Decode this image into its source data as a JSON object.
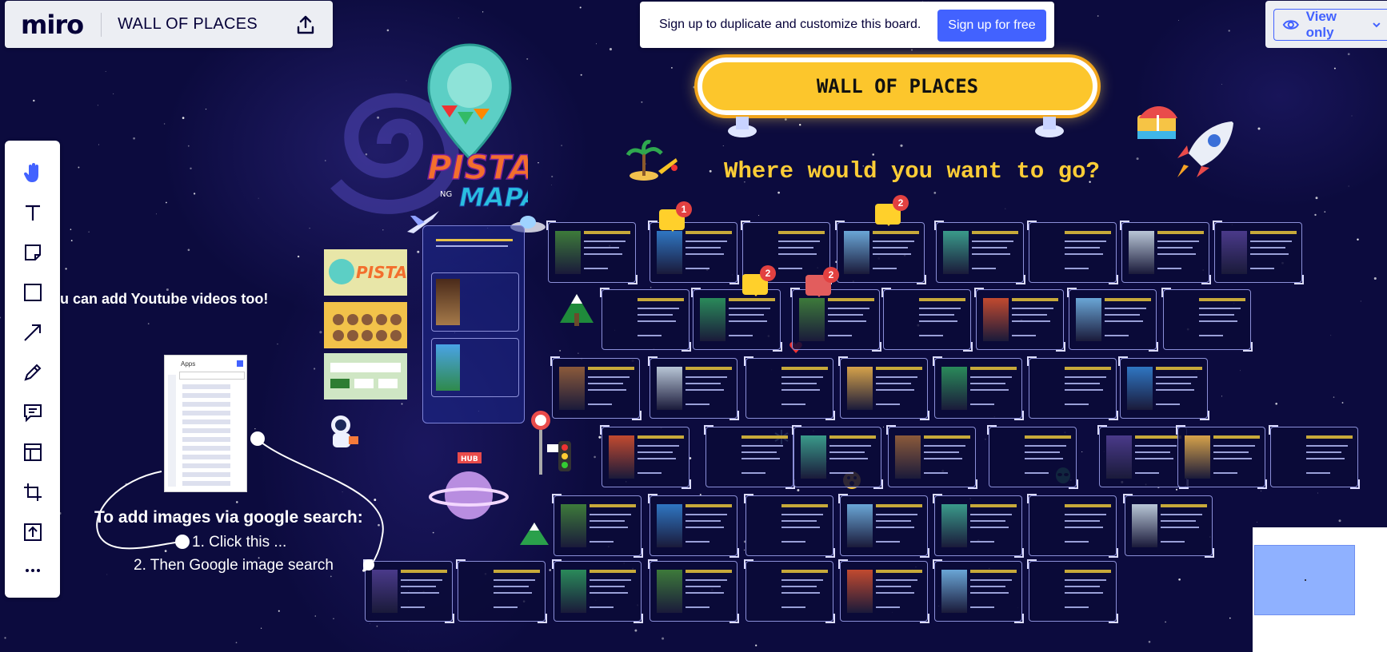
{
  "app": {
    "logo": "miro",
    "board_name": "WALL OF PLACES",
    "export_icon": "upload-icon"
  },
  "signup_banner": {
    "text": "Sign up to duplicate and customize this board.",
    "button": "Sign up for free"
  },
  "view_mode": {
    "label": "View only",
    "icon": "eye-icon"
  },
  "toolbar": {
    "tools": [
      {
        "name": "hand-icon",
        "active": true
      },
      {
        "name": "text-icon",
        "active": false
      },
      {
        "name": "sticky-note-icon",
        "active": false
      },
      {
        "name": "shape-icon",
        "active": false
      },
      {
        "name": "arrow-icon",
        "active": false
      },
      {
        "name": "pen-icon",
        "active": false
      },
      {
        "name": "comment-icon",
        "active": false
      },
      {
        "name": "frame-icon",
        "active": false
      },
      {
        "name": "crop-icon",
        "active": false
      },
      {
        "name": "upload-icon",
        "active": false
      },
      {
        "name": "more-icon",
        "active": false
      }
    ]
  },
  "board": {
    "title": "WALL OF PLACES",
    "question": "Where would you want to go?",
    "youtube_hint": "ou can add Youtube videos too!",
    "google_hint": "To add images via google search:",
    "step1": "1. Click this ...",
    "step2": "2. Then Google image search",
    "apps_panel_title": "Apps",
    "branding": "PISTA NG MAPA"
  },
  "comments": [
    {
      "count": "1"
    },
    {
      "count": "2"
    },
    {
      "count": "2"
    },
    {
      "count": "2"
    }
  ],
  "colors": {
    "background": "#0c0b3e",
    "accent": "#4262ff",
    "title_fill": "#fcc62c",
    "question_text": "#fccd36"
  }
}
